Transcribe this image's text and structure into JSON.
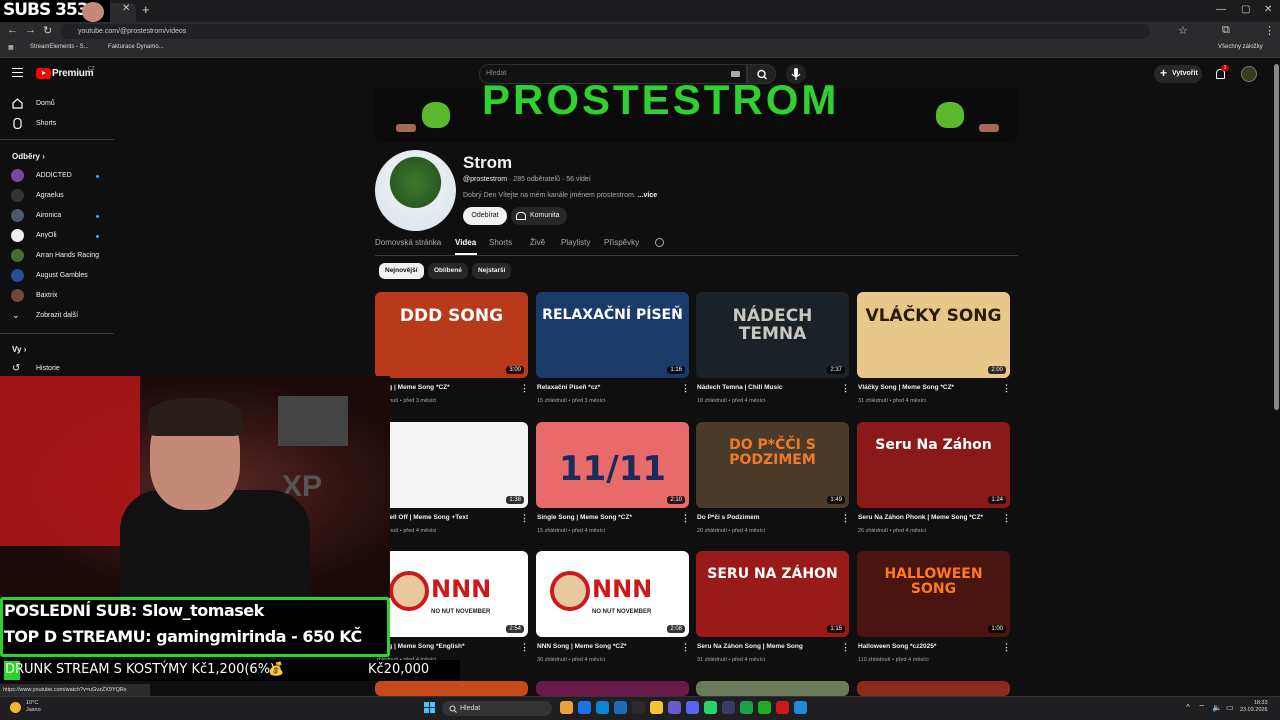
{
  "browser": {
    "url": "youtube.com/@prostestrom/videos",
    "status_url": "https://www.youtube.com/watch?v=uGvzZX9YQRs",
    "bookmarks": [
      "StreamElements - S...",
      "Fakturace Dynamo..."
    ],
    "all_bookmarks": "Všechny záložky"
  },
  "header": {
    "logo": "Premium",
    "logo_country": "CZ",
    "search_placeholder": "Hledat",
    "create_label": "Vytvořit",
    "notif_count": "1"
  },
  "sidebar": {
    "home": "Domů",
    "shorts": "Shorts",
    "subscriptions_title": "Odběry",
    "subscriptions": [
      {
        "name": "ADDICTED",
        "color": "#7a4a9a",
        "dot": true
      },
      {
        "name": "Agraelus",
        "color": "#333333",
        "dot": false
      },
      {
        "name": "Aironica",
        "color": "#4a5a6a",
        "dot": true
      },
      {
        "name": "AnyOli",
        "color": "#eeeeee",
        "dot": true
      },
      {
        "name": "Arran Hands Racing",
        "color": "#4a6a3a",
        "dot": false
      },
      {
        "name": "August Gambles",
        "color": "#2a4a9a",
        "dot": false
      },
      {
        "name": "Baxtrix",
        "color": "#6a4a3a",
        "dot": false
      }
    ],
    "show_more": "Zobrazit další",
    "you_title": "Vy",
    "history": "Historie"
  },
  "channel": {
    "banner_text": "PROSTESTROM",
    "name": "Strom",
    "handle": "@prostestrom",
    "subscribers": "285 odběratelů",
    "video_count": "56 videí",
    "description": "Dobrý Den Vítejte na mém kanále jménem prostestrom.",
    "more_label": "...více",
    "subscribe_label": "Odebírat",
    "community_label": "Komunita",
    "tabs": [
      "Domovská stránka",
      "Videa",
      "Shorts",
      "Živě",
      "Playlisty",
      "Příspěvky"
    ],
    "active_tab": "Videa",
    "chips": [
      "Nejnovější",
      "Oblíbené",
      "Nejstarší"
    ]
  },
  "videos": [
    {
      "title": "Song | Meme Song *CZ*",
      "views": "zhlédnutí",
      "age": "před 3 měsíci",
      "duration": "3:00",
      "thumb_text": "DDD SONG",
      "bg": "#b83a1a",
      "fg": "#ffffff"
    },
    {
      "title": "Relaxační Píseň *cz*",
      "views": "15 zhlédnutí",
      "age": "před 3 měsíci",
      "duration": "1:16",
      "thumb_text": "RELAXAČNÍ PÍSEŇ",
      "bg": "#1a3a6a",
      "fg": "#ffffff"
    },
    {
      "title": "Nádech Temna | Chill Music",
      "views": "18 zhlédnutí",
      "age": "před 4 měsíci",
      "duration": "2:37",
      "thumb_text": "NÁDECH TEMNA",
      "bg": "#1a2228",
      "fg": "#c8c8c0"
    },
    {
      "title": "Vláčky Song | Meme Song *CZ*",
      "views": "31 zhlédnutí",
      "age": "před 4 měsíci",
      "duration": "2:00",
      "thumb_text": "VLÁČKY SONG",
      "bg": "#e8c88a",
      "fg": "#2a1a0a"
    },
    {
      "title": "en Fell Off | Meme Song +Text",
      "views": "zhlédnutí",
      "age": "před 4 měsíci",
      "duration": "1:38",
      "thumb_text": "",
      "bg": "#f4f4f4",
      "fg": "#cc1a1a"
    },
    {
      "title": "Single Song | Meme Song *CZ*",
      "views": "15 zhlédnutí",
      "age": "před 4 měsíci",
      "duration": "2:10",
      "thumb_text": "11/11",
      "bg": "#e86a6a",
      "fg": "#1a2a5a"
    },
    {
      "title": "Do P*či s Podzimem",
      "views": "20 zhlédnutí",
      "age": "před 4 měsíci",
      "duration": "1:49",
      "thumb_text": "DO P*ČČI S PODZIMEM",
      "bg": "#4a3a2a",
      "fg": "#f07a2a"
    },
    {
      "title": "Seru Na Záhon Phonk | Meme Song *CZ*",
      "views": "26 zhlédnutí",
      "age": "před 4 měsíci",
      "duration": "1:24",
      "thumb_text": "Seru Na Záhon",
      "bg": "#8a1a1a",
      "fg": "#ffffff"
    },
    {
      "title": "Song | Meme Song *English*",
      "views": "zhlédnutí",
      "age": "před 4 měsíci",
      "duration": "2:54",
      "thumb_text": "NNN",
      "bg": "#ffffff",
      "fg": "#cc1a1a"
    },
    {
      "title": "NNN Song | Meme Song *CZ*",
      "views": "30 zhlédnutí",
      "age": "před 4 měsíci",
      "duration": "2:08",
      "thumb_text": "NNN",
      "bg": "#ffffff",
      "fg": "#cc1a1a"
    },
    {
      "title": "Seru Na Záhon Song | Meme Song",
      "views": "31 zhlédnutí",
      "age": "před 4 měsíci",
      "duration": "1:15",
      "thumb_text": "SERU NA ZÁHON",
      "bg": "#9a1a1a",
      "fg": "#ffffff"
    },
    {
      "title": "Halloween Song *cz2025*",
      "views": "110 zhlédnutí",
      "age": "před 4 měsíci",
      "duration": "1:00",
      "thumb_text": "HALLOWEEN SONG",
      "bg": "#4a1410",
      "fg": "#ff7a1a"
    }
  ],
  "overlay": {
    "subs_label": "SUBS 353/",
    "last_sub": "POSLEDNÍ SUB: Slow_tomasek",
    "top_donation": "TOP D STREAMU: gamingmirinda - 650 KČ",
    "goal_text": "DRUNK STREAM S KOSTÝMY Kč1,200(6%)",
    "goal_progress": 0.06,
    "goal_target": "Kč20,000",
    "no_nut_text": "NO NUT NOVEMBER"
  },
  "taskbar": {
    "temp": "10°C",
    "weather": "Jasno",
    "search": "Hledat",
    "time": "18:33",
    "date": "23.03.2026"
  }
}
